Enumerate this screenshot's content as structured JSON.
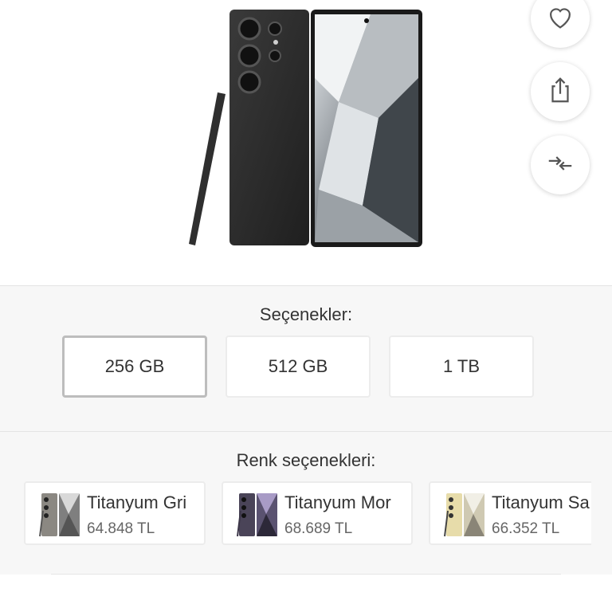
{
  "product": {
    "image_label": "samsung-galaxy-s24-ultra"
  },
  "actions": {
    "favorite_icon": "heart-icon",
    "share_icon": "share-icon",
    "compare_icon": "compare-arrows-icon"
  },
  "storage": {
    "title": "Seçenekler:",
    "options": [
      {
        "label": "256 GB",
        "selected": true
      },
      {
        "label": "512 GB",
        "selected": false
      },
      {
        "label": "1 TB",
        "selected": false
      }
    ]
  },
  "colors": {
    "title": "Renk seçenekleri:",
    "options": [
      {
        "name": "Titanyum Gri",
        "price": "64.848 TL",
        "swatch": "#8b8882"
      },
      {
        "name": "Titanyum Mor",
        "price": "68.689 TL",
        "swatch": "#4a4458"
      },
      {
        "name": "Titanyum Sa",
        "price": "66.352 TL",
        "swatch": "#e7dcaa"
      }
    ]
  },
  "colors_palette": {
    "background": "#ffffff",
    "panel": "#f7f7f7",
    "border": "#ececec",
    "selected_border": "#bdbdbd",
    "text": "#333333"
  }
}
